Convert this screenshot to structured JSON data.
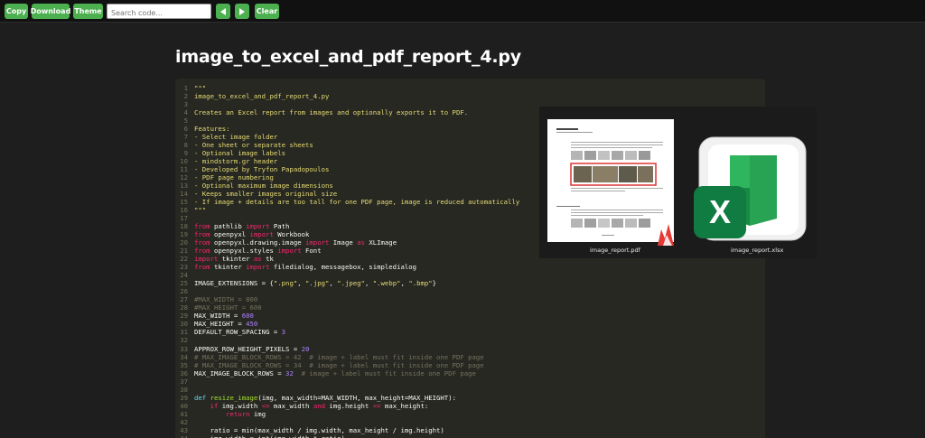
{
  "toolbar": {
    "copy_label": "Copy",
    "download_label": "Download",
    "theme_label": "Theme",
    "search_placeholder": "Search code...",
    "clear_label": "Clear"
  },
  "page_title": "image_to_excel_and_pdf_report_4.py",
  "preview": {
    "pdf_caption": "image_report.pdf",
    "xlsx_caption": "image_report.xlsx"
  },
  "code_lines": [
    [
      [
        "s",
        "\"\"\""
      ]
    ],
    [
      [
        "s",
        "image_to_excel_and_pdf_report_4.py"
      ]
    ],
    [],
    [
      [
        "s",
        "Creates an Excel report from images and optionally exports it to PDF."
      ]
    ],
    [],
    [
      [
        "s",
        "Features:"
      ]
    ],
    [
      [
        "s",
        "- Select image folder"
      ]
    ],
    [
      [
        "s",
        "- One sheet or separate sheets"
      ]
    ],
    [
      [
        "s",
        "- Optional image labels"
      ]
    ],
    [
      [
        "s",
        "- mindstorm.gr header"
      ]
    ],
    [
      [
        "s",
        "- Developed by Tryfon Papadopoulos"
      ]
    ],
    [
      [
        "s",
        "- PDF page numbering"
      ]
    ],
    [
      [
        "s",
        "- Optional maximum image dimensions"
      ]
    ],
    [
      [
        "s",
        "- Keeps smaller images original size"
      ]
    ],
    [
      [
        "s",
        "- If image + details are too tall for one PDF page, image is reduced automatically"
      ]
    ],
    [
      [
        "s",
        "\"\"\""
      ]
    ],
    [],
    [
      [
        "k",
        "from"
      ],
      [
        "p",
        " pathlib "
      ],
      [
        "k",
        "import"
      ],
      [
        "p",
        " Path"
      ]
    ],
    [
      [
        "k",
        "from"
      ],
      [
        "p",
        " openpyxl "
      ],
      [
        "k",
        "import"
      ],
      [
        "p",
        " Workbook"
      ]
    ],
    [
      [
        "k",
        "from"
      ],
      [
        "p",
        " openpyxl.drawing.image "
      ],
      [
        "k",
        "import"
      ],
      [
        "p",
        " Image "
      ],
      [
        "k",
        "as"
      ],
      [
        "p",
        " XLImage"
      ]
    ],
    [
      [
        "k",
        "from"
      ],
      [
        "p",
        " openpyxl.styles "
      ],
      [
        "k",
        "import"
      ],
      [
        "p",
        " Font"
      ]
    ],
    [
      [
        "k",
        "import"
      ],
      [
        "p",
        " tkinter "
      ],
      [
        "k",
        "as"
      ],
      [
        "p",
        " tk"
      ]
    ],
    [
      [
        "k",
        "from"
      ],
      [
        "p",
        " tkinter "
      ],
      [
        "k",
        "import"
      ],
      [
        "p",
        " filedialog, messagebox, simpledialog"
      ]
    ],
    [],
    [
      [
        "p",
        "IMAGE_EXTENSIONS = {"
      ],
      [
        "s",
        "\".png\""
      ],
      [
        "p",
        ", "
      ],
      [
        "s",
        "\".jpg\""
      ],
      [
        "p",
        ", "
      ],
      [
        "s",
        "\".jpeg\""
      ],
      [
        "p",
        ", "
      ],
      [
        "s",
        "\".webp\""
      ],
      [
        "p",
        ", "
      ],
      [
        "s",
        "\".bmp\""
      ],
      [
        "p",
        "}"
      ]
    ],
    [],
    [
      [
        "c",
        "#MAX_WIDTH = 800"
      ]
    ],
    [
      [
        "c",
        "#MAX_HEIGHT = 600"
      ]
    ],
    [
      [
        "p",
        "MAX_WIDTH = "
      ],
      [
        "n",
        "600"
      ]
    ],
    [
      [
        "p",
        "MAX_HEIGHT = "
      ],
      [
        "n",
        "450"
      ]
    ],
    [
      [
        "p",
        "DEFAULT_ROW_SPACING = "
      ],
      [
        "n",
        "3"
      ]
    ],
    [],
    [
      [
        "p",
        "APPROX_ROW_HEIGHT_PIXELS = "
      ],
      [
        "n",
        "20"
      ]
    ],
    [
      [
        "c",
        "# MAX_IMAGE_BLOCK_ROWS = 42  # image + label must fit inside one PDF page"
      ]
    ],
    [
      [
        "c",
        "# MAX_IMAGE_BLOCK_ROWS = 34  # image + label must fit inside one PDF page"
      ]
    ],
    [
      [
        "p",
        "MAX_IMAGE_BLOCK_ROWS = "
      ],
      [
        "n",
        "32"
      ],
      [
        "c",
        "  # image + label must fit inside one PDF page"
      ]
    ],
    [],
    [],
    [
      [
        "d",
        "def"
      ],
      [
        "p",
        " "
      ],
      [
        "f",
        "resize_image"
      ],
      [
        "p",
        "(img, max_width=MAX_WIDTH, max_height=MAX_HEIGHT):"
      ]
    ],
    [
      [
        "p",
        "    "
      ],
      [
        "k",
        "if"
      ],
      [
        "p",
        " img.width "
      ],
      [
        "k",
        "<="
      ],
      [
        "p",
        " max_width "
      ],
      [
        "k",
        "and"
      ],
      [
        "p",
        " img.height "
      ],
      [
        "k",
        "<="
      ],
      [
        "p",
        " max_height:"
      ]
    ],
    [
      [
        "p",
        "        "
      ],
      [
        "k",
        "return"
      ],
      [
        "p",
        " img"
      ]
    ],
    [],
    [
      [
        "p",
        "    ratio = min(max_width / img.width, max_height / img.height)"
      ]
    ],
    [
      [
        "p",
        "    img.width = int(img.width * ratio)"
      ]
    ]
  ]
}
